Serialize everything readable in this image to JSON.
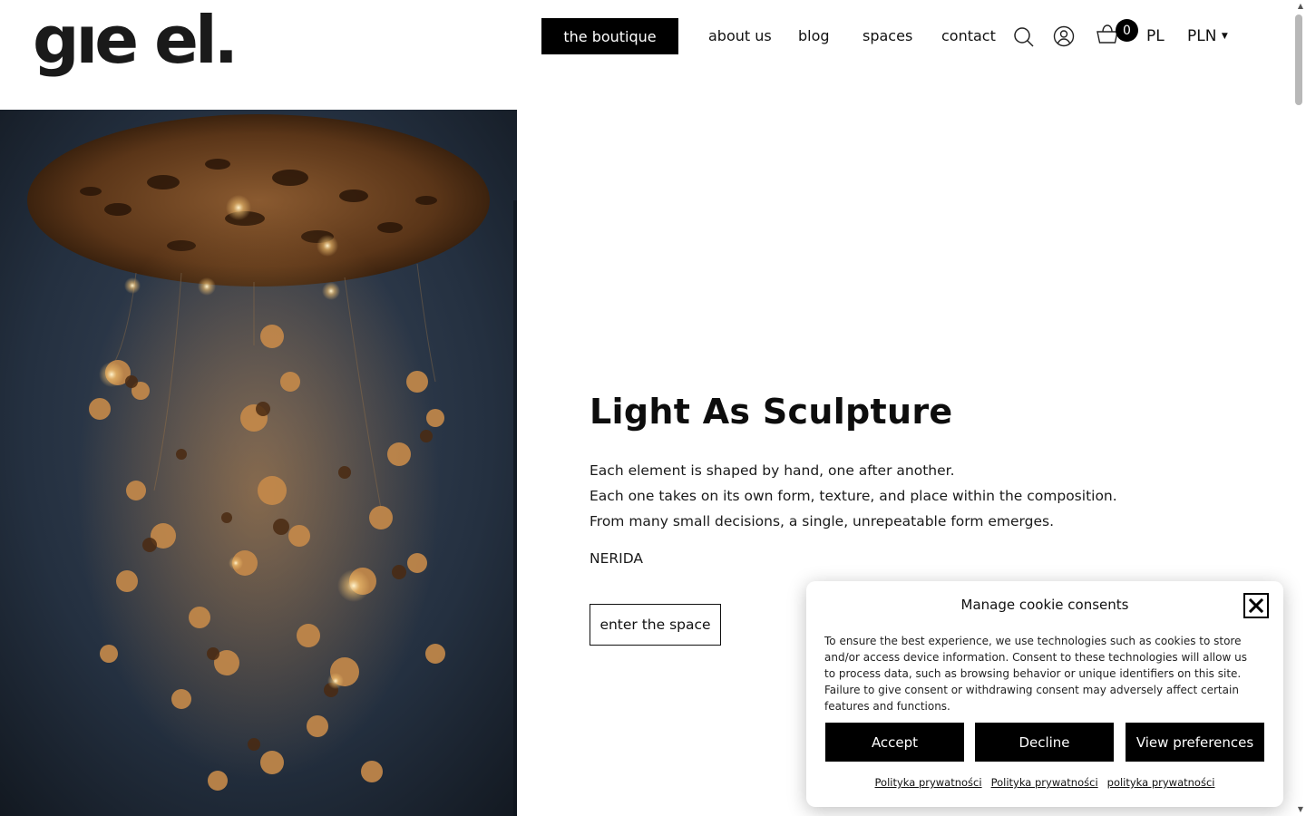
{
  "header": {
    "logo_text": "gıe el.",
    "nav": {
      "primary": "the boutique",
      "links": [
        "about us",
        "blog",
        "spaces",
        "contact"
      ]
    },
    "icons": {
      "search": "search-icon",
      "account": "user-icon",
      "cart": "cart-icon"
    },
    "cart_count": "0",
    "language": "PL",
    "currency": "PLN"
  },
  "hero": {
    "title": "Light As Sculpture",
    "lines": [
      "Each element is shaped by hand, one after another.",
      "Each one takes on its own form, texture, and place within the composition.",
      "From many small decisions, a single, unrepeatable form emerges."
    ],
    "tag": "NERIDA",
    "cta": "enter the space"
  },
  "cookie": {
    "title": "Manage cookie consents",
    "text": "To ensure the best experience, we use technologies such as cookies to store and/or access device information. Consent to these technologies will allow us to process data, such as browsing behavior or unique identifiers on this site. Failure to give consent or withdrawing consent may adversely affect certain features and functions.",
    "buttons": {
      "accept": "Accept",
      "decline": "Decline",
      "preferences": "View preferences"
    },
    "links": [
      "Polityka prywatności",
      "Polityka prywatności",
      "polityka prywatności"
    ]
  },
  "colors": {
    "primary": "#000000",
    "background": "#ffffff",
    "text": "#111111"
  }
}
